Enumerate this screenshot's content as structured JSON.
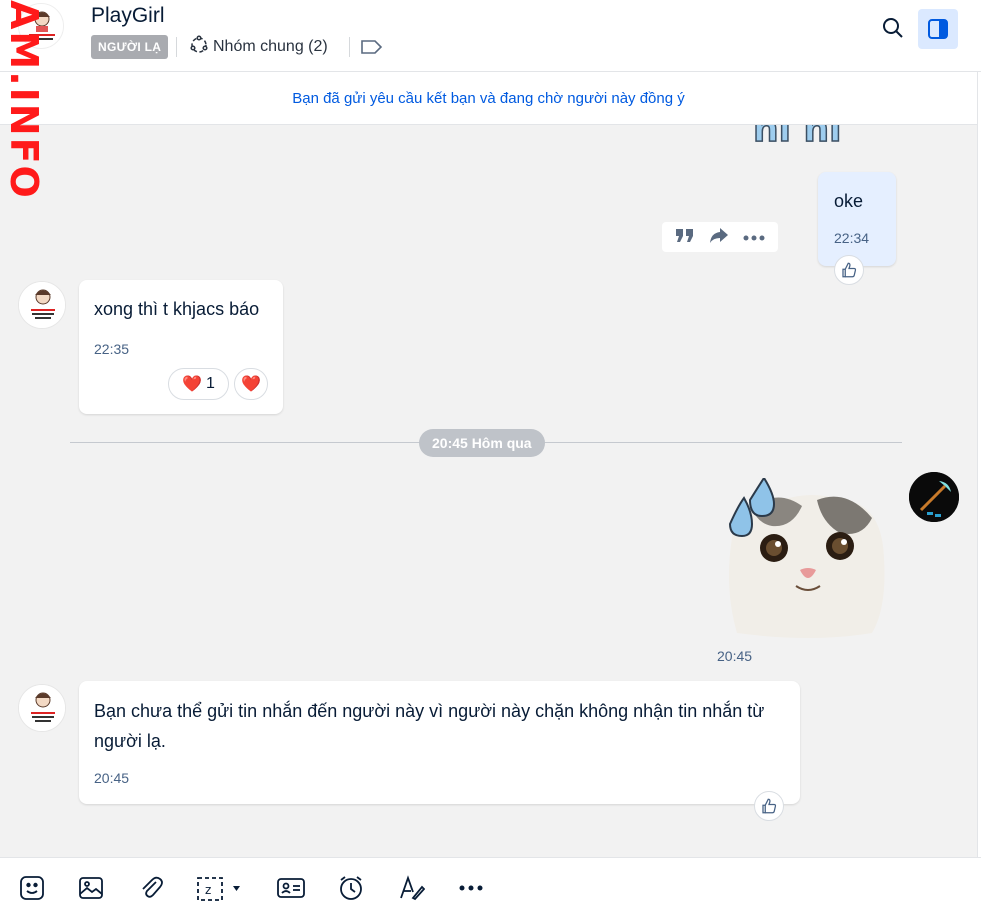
{
  "header": {
    "title": "PlayGirl",
    "badge": "NGƯỜI LẠ",
    "group_label": "Nhóm chung (2)"
  },
  "watermark": "AM.INFO",
  "notice": "Bạn đã gửi yêu cầu kết bạn và đang chờ người này đồng ý",
  "messages": [
    {
      "sender": "me",
      "text": "oke",
      "time": "22:34"
    },
    {
      "sender": "other",
      "text": "xong thì t khjacs báo",
      "time": "22:35",
      "reactions": [
        {
          "emoji": "❤️",
          "count": "1"
        }
      ]
    },
    {
      "sender": "me",
      "type": "sticker",
      "time": "20:45"
    },
    {
      "sender": "system",
      "text": "Bạn chưa thể gửi tin nhắn đến người này vì người này chặn không nhận tin nhắn từ người lạ.",
      "time": "20:45"
    }
  ],
  "date_divider": "20:45 Hôm qua",
  "sticker_top_text": "hi hi",
  "reaction_heart": "❤️",
  "colors": {
    "accent": "#005ae0",
    "my_bubble": "#e5efff",
    "badge_bg": "#a9abb0",
    "heart": "#e0192b"
  },
  "toolbar_icons": [
    "sticker-icon",
    "image-icon",
    "attach-icon",
    "screenshot-icon",
    "contact-card-icon",
    "reminder-icon",
    "format-text-icon",
    "more-icon"
  ]
}
